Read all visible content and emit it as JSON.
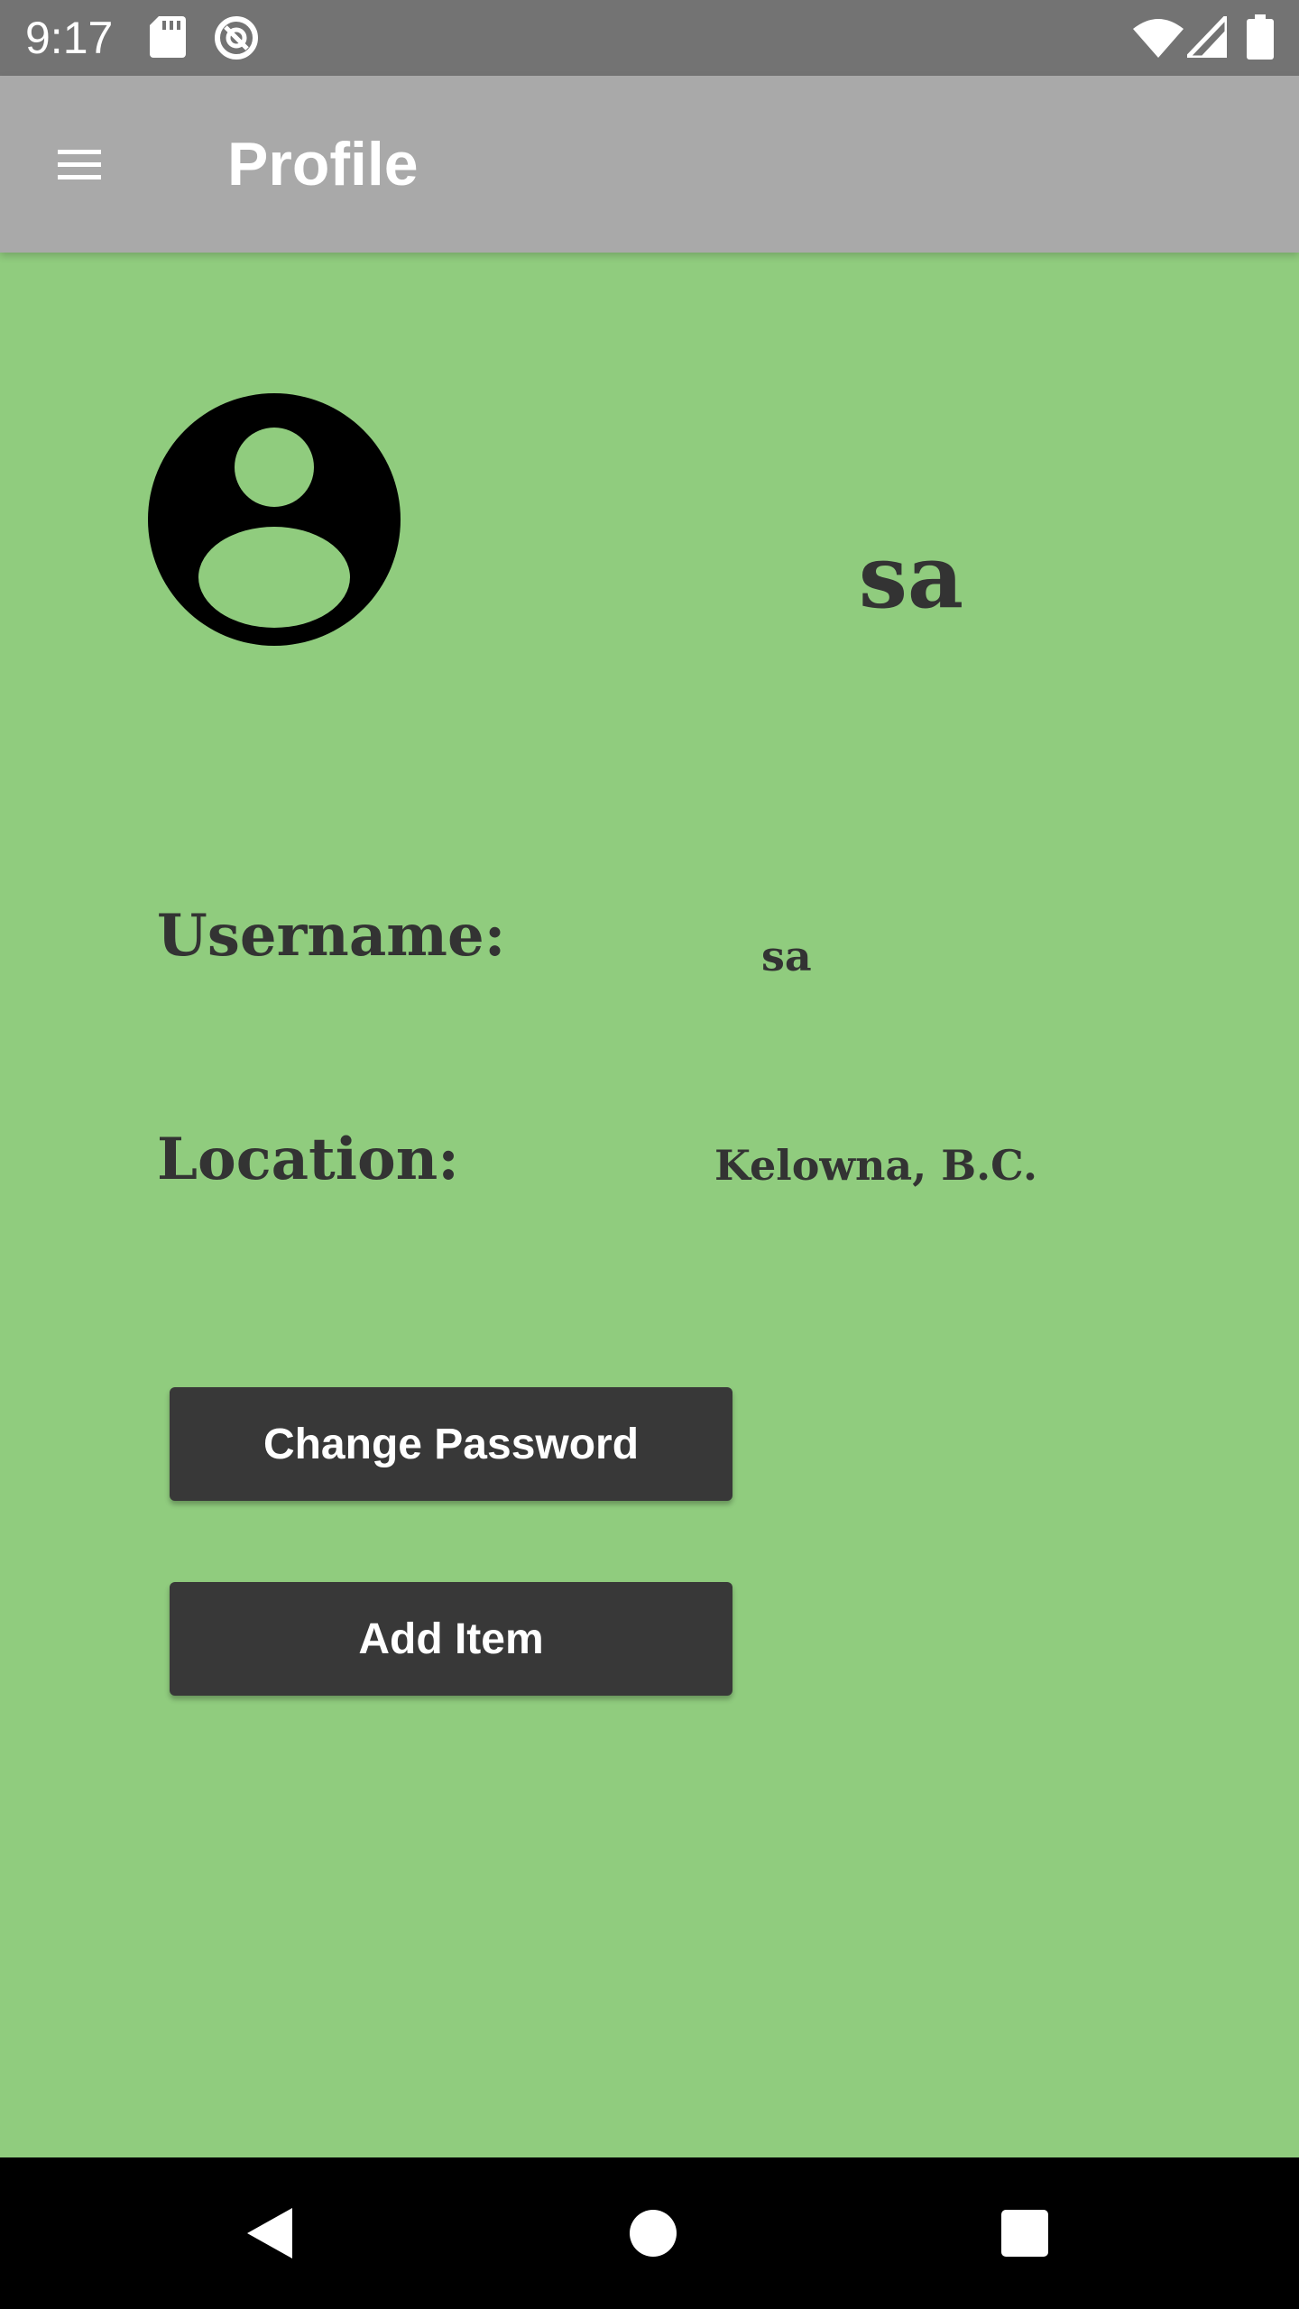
{
  "status_bar": {
    "time": "9:17",
    "icons": [
      "sd-card-icon",
      "sync-icon",
      "wifi-icon",
      "signal-icon",
      "battery-icon"
    ]
  },
  "app_bar": {
    "title": "Profile",
    "menu_icon": "menu-icon"
  },
  "profile": {
    "avatar_icon": "account-circle-icon",
    "display_name": "sa",
    "fields": [
      {
        "label": "Username:",
        "value": "sa"
      },
      {
        "label": "Location:",
        "value": "Kelowna, B.C."
      }
    ]
  },
  "actions": {
    "change_password_label": "Change Password",
    "add_item_label": "Add Item"
  },
  "nav_bar": {
    "icons": [
      "back-icon",
      "home-icon",
      "recents-icon"
    ]
  },
  "colors": {
    "background": "#90CC7E",
    "app_bar": "#A9A9A9",
    "status_bar": "#737373",
    "button": "#383838",
    "text": "#333333"
  }
}
